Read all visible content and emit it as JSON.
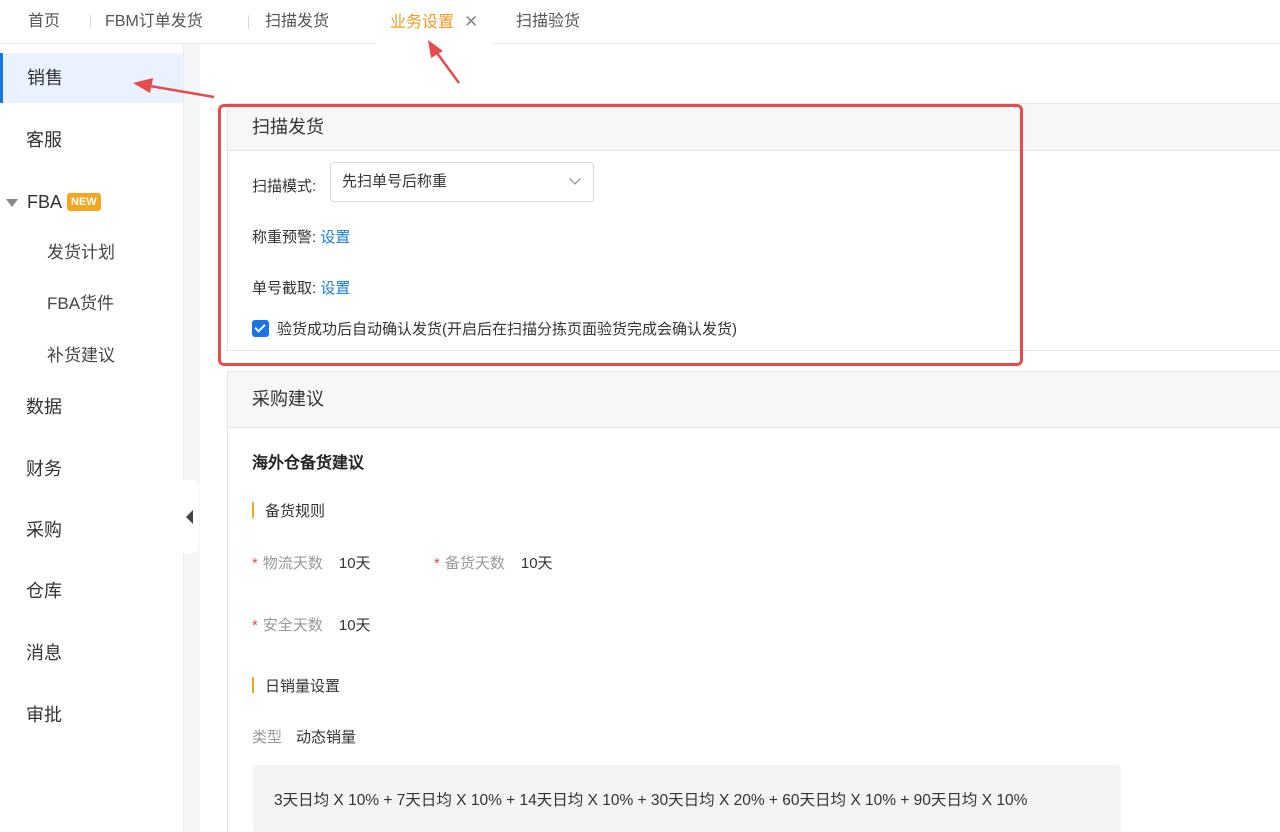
{
  "tabs": [
    {
      "label": "首页"
    },
    {
      "label": "FBM订单发货"
    },
    {
      "label": "扫描发货"
    },
    {
      "label": "业务设置",
      "active": true
    },
    {
      "label": "扫描验货"
    }
  ],
  "sidebar": {
    "items": [
      {
        "label": "销售",
        "active": true
      },
      {
        "label": "客服"
      },
      {
        "label": "FBA",
        "badge": "NEW"
      },
      {
        "label": "发货计划"
      },
      {
        "label": "FBA货件"
      },
      {
        "label": "补货建议"
      },
      {
        "label": "数据"
      },
      {
        "label": "财务"
      },
      {
        "label": "采购"
      },
      {
        "label": "仓库"
      },
      {
        "label": "消息"
      },
      {
        "label": "审批"
      }
    ]
  },
  "scan_section": {
    "title": "扫描发货",
    "mode_label": "扫描模式:",
    "mode_value": "先扫单号后称重",
    "weight_alert_label": "称重预警:",
    "weight_alert_link": "设置",
    "order_cut_label": "单号截取:",
    "order_cut_link": "设置",
    "auto_confirm_checked": true,
    "auto_confirm_text": "验货成功后自动确认发货(开启后在扫描分拣页面验货完成会确认发货)"
  },
  "purchase_section": {
    "title": "采购建议",
    "subtitle": "海外仓备货建议",
    "rule_title": "备货规则",
    "fields": [
      {
        "label": "物流天数",
        "value": "10天"
      },
      {
        "label": "备货天数",
        "value": "10天"
      },
      {
        "label": "安全天数",
        "value": "10天"
      }
    ],
    "daily_sales_title": "日销量设置",
    "type_label": "类型",
    "type_value": "动态销量",
    "formula": "3天日均 X 10% + 7天日均 X 10% + 14天日均 X 10% + 30天日均 X 20% + 60天日均 X 10% + 90天日均 X 10%"
  },
  "colors": {
    "accent": "#f59a23",
    "primary": "#1b74e4",
    "annotation": "#e84b4b"
  }
}
